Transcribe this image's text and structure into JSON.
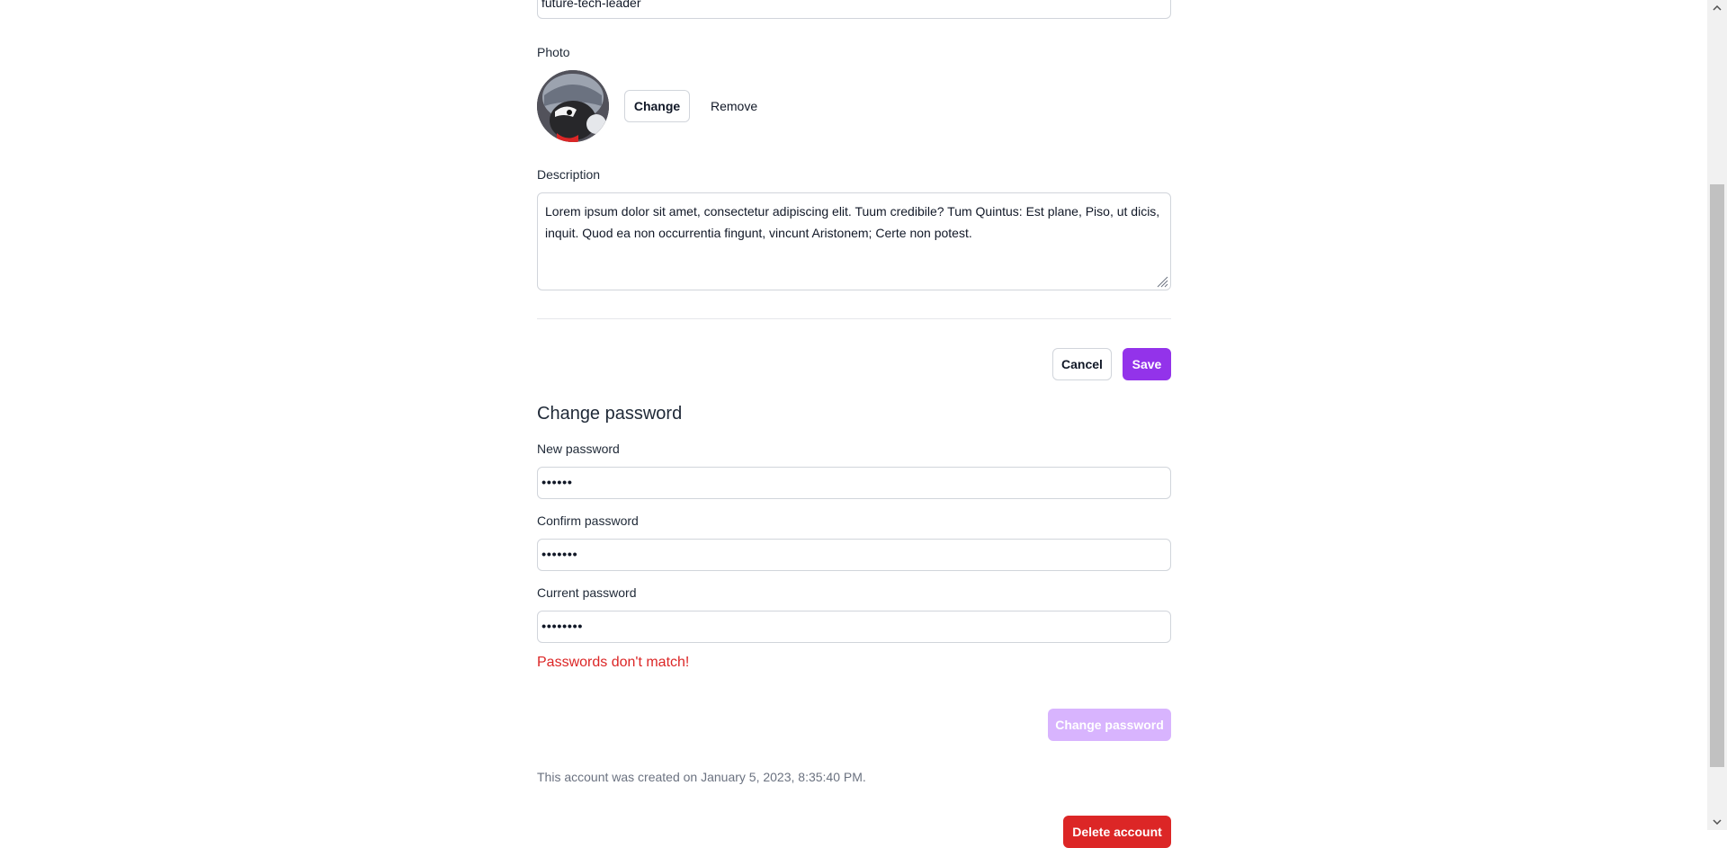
{
  "username_field": {
    "value": "future-tech-leader"
  },
  "photo": {
    "label": "Photo",
    "change_label": "Change",
    "remove_label": "Remove"
  },
  "description": {
    "label": "Description",
    "value": "Lorem ipsum dolor sit amet, consectetur adipiscing elit. Tuum credibile? Tum Quintus: Est plane, Piso, ut dicis, inquit. Quod ea non occurrentia fingunt, vincunt Aristonem; Certe non potest."
  },
  "profile_actions": {
    "cancel_label": "Cancel",
    "save_label": "Save"
  },
  "change_password": {
    "title": "Change password",
    "new_password": {
      "label": "New password",
      "value": "••••••"
    },
    "confirm_password": {
      "label": "Confirm password",
      "value": "•••••••"
    },
    "current_password": {
      "label": "Current password",
      "value": "••••••••"
    },
    "error": "Passwords don't match!",
    "submit_label": "Change password"
  },
  "account": {
    "created_text": "This account was created on January 5, 2023, 8:35:40 PM.",
    "delete_label": "Delete account"
  },
  "colors": {
    "primary": "#9333ea",
    "primary_disabled": "#d8b4fe",
    "danger": "#dc2626",
    "border": "#d1d5db"
  }
}
